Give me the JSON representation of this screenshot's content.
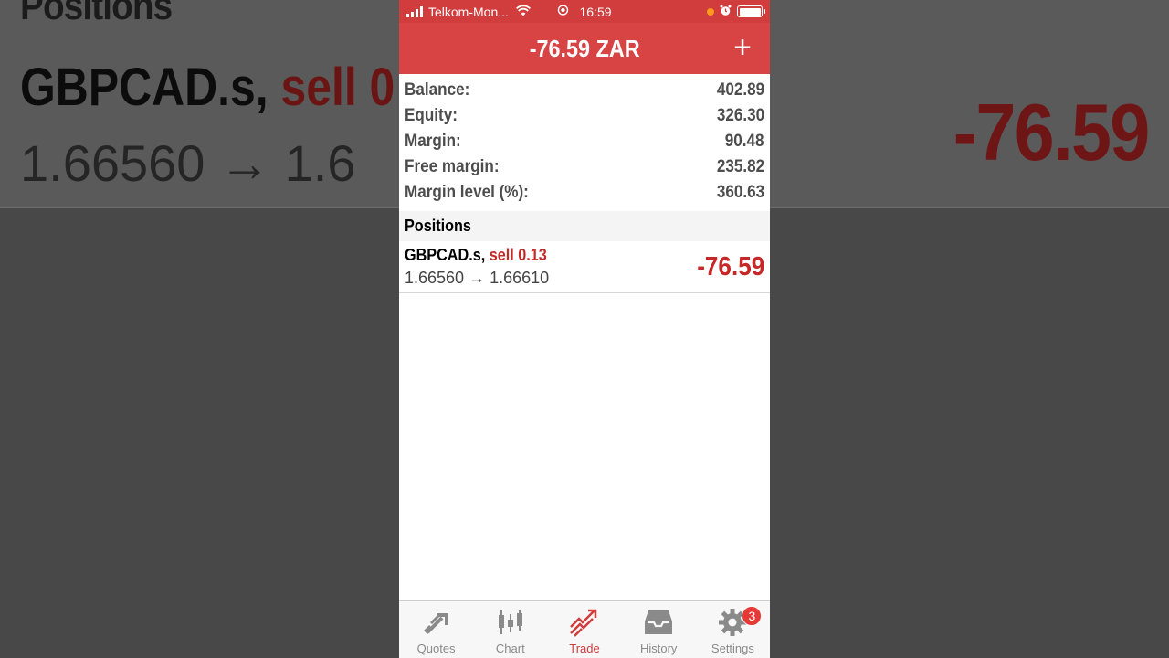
{
  "status_bar": {
    "carrier": "Telkom-Mon...",
    "time": "16:59"
  },
  "header": {
    "title": "-76.59 ZAR",
    "add_label": "+"
  },
  "summary": [
    {
      "label": "Balance:",
      "value": "402.89"
    },
    {
      "label": "Equity:",
      "value": "326.30"
    },
    {
      "label": "Margin:",
      "value": "90.48"
    },
    {
      "label": "Free margin:",
      "value": "235.82"
    },
    {
      "label": "Margin level (%):",
      "value": "360.63"
    }
  ],
  "positions": {
    "header": "Positions",
    "items": [
      {
        "symbol": "GBPCAD.s,",
        "side": "sell 0.13",
        "prices": "1.66560 → 1.66610",
        "profit": "-76.59"
      }
    ]
  },
  "tabs": [
    {
      "label": "Quotes",
      "icon": "quotes-icon"
    },
    {
      "label": "Chart",
      "icon": "chart-icon"
    },
    {
      "label": "Trade",
      "icon": "trade-icon",
      "active": true
    },
    {
      "label": "History",
      "icon": "history-icon"
    },
    {
      "label": "Settings",
      "icon": "settings-icon",
      "badge": "3"
    }
  ],
  "background": {
    "title": "Positions",
    "symbol": "GBPCAD.s,",
    "side": "sell 0",
    "prices": "1.66560 → 1.6",
    "profit": "-76.59"
  },
  "colors": {
    "accent": "#d84343",
    "status_bar": "#d13c3c",
    "loss": "#c62828",
    "badge": "#e53935"
  }
}
